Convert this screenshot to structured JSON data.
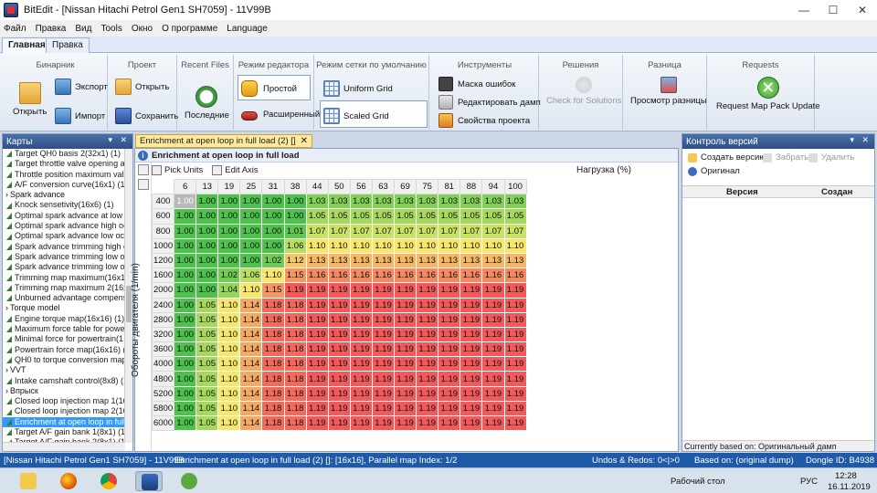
{
  "window": {
    "title": "BitEdit - [Nissan Hitachi Petrol Gen1 SH7059] - 11V99B",
    "minimize": "—",
    "maximize": "☐",
    "close": "✕"
  },
  "menu": [
    "Файл",
    "Правка",
    "Вид",
    "Tools",
    "Окно",
    "О программе",
    "Language"
  ],
  "ribbon_tabs": [
    "Главная",
    "Правка"
  ],
  "ribbon": {
    "binary": {
      "title": "Бинарник",
      "open": "Открыть",
      "export": "Экспорт",
      "import": "Импорт"
    },
    "project": {
      "title": "Проект",
      "open": "Открыть",
      "save": "Сохранить"
    },
    "recent": {
      "title": "Recent Files",
      "recent": "Последние"
    },
    "mode": {
      "title": "Режим редактора",
      "simple": "Простой",
      "advanced": "Расширенный"
    },
    "gridmode": {
      "title": "Режим сетки по умолчанию",
      "uniform": "Uniform Grid",
      "scaled": "Scaled Grid"
    },
    "tools": {
      "title": "Инструменты",
      "errmask": "Маска ошибок",
      "dtc": "Редактировать дамп",
      "props": "Свойства проекта"
    },
    "solutions": {
      "title": "Решения",
      "check": "Check for Solutions"
    },
    "diff": {
      "title": "Разница",
      "view": "Просмотр разницы"
    },
    "requests": {
      "title": "Requests",
      "update": "Request Map Pack Update"
    }
  },
  "maps_panel": {
    "title": "Карты",
    "pin": "▾ ✕",
    "items": [
      {
        "label": "Target QH0 basis 2(32x1) (1)",
        "cat": false
      },
      {
        "label": "Target throttle valve opening a",
        "cat": false
      },
      {
        "label": "Throttle position maximum val",
        "cat": false
      },
      {
        "label": "A/F conversion curve(16x1) (1)",
        "cat": false
      },
      {
        "label": "Spark advance",
        "cat": true
      },
      {
        "label": "Knock sensetivity(16x6) (1)",
        "cat": false
      },
      {
        "label": "Optimal spark advance at low l",
        "cat": false
      },
      {
        "label": "Optimal spark advance high oc",
        "cat": false
      },
      {
        "label": "Optimal spark advance low oct",
        "cat": false
      },
      {
        "label": "Spark advance trimming high c",
        "cat": false
      },
      {
        "label": "Spark advance trimming low o",
        "cat": false
      },
      {
        "label": "Spark advance trimming low o",
        "cat": false
      },
      {
        "label": "Trimming map maximum(16x1",
        "cat": false
      },
      {
        "label": "Trimming map maximum 2(16x",
        "cat": false
      },
      {
        "label": "Unburned advantage compens",
        "cat": false
      },
      {
        "label": "Torque model",
        "cat": true
      },
      {
        "label": "Engine torque map(16x16) (1)",
        "cat": false
      },
      {
        "label": "Maximum force table for powe",
        "cat": false
      },
      {
        "label": "Minimal force for powertrain(1",
        "cat": false
      },
      {
        "label": "Powertrain force map(16x16) (",
        "cat": false
      },
      {
        "label": "QH0 to torque conversion map",
        "cat": false
      },
      {
        "label": "VVT",
        "cat": true
      },
      {
        "label": "Intake camshaft control(8x8) (1",
        "cat": false
      },
      {
        "label": "Впрыск",
        "cat": true
      },
      {
        "label": "Closed loop injection map 1(16",
        "cat": false
      },
      {
        "label": "Closed loop injection map 2(16",
        "cat": false
      },
      {
        "label": "Enrichment at open loop in full",
        "cat": false,
        "selected": true
      },
      {
        "label": "Target A/F gain bank 1(8x1) (1)",
        "cat": false
      },
      {
        "label": "Target A/F gain bank 2(8x1) (1)",
        "cat": false
      }
    ]
  },
  "doc": {
    "tab": "Enrichment at open loop in full load (2) []",
    "tab_close": "✕",
    "header": "Enrichment at open loop in full load",
    "pick_units": "Pick Units",
    "edit_axis": "Edit Axis",
    "load_label": "Нагрузка (%)",
    "rpm_label": "Обороты двигателя (1/min)",
    "cols": [
      "6",
      "13",
      "19",
      "25",
      "31",
      "38",
      "44",
      "50",
      "56",
      "63",
      "69",
      "75",
      "81",
      "88",
      "94",
      "100"
    ],
    "rows": [
      {
        "rpm": "400",
        "v": [
          "1.00",
          "1.00",
          "1.00",
          "1.00",
          "1.00",
          "1.00",
          "1.03",
          "1.03",
          "1.03",
          "1.03",
          "1.03",
          "1.03",
          "1.03",
          "1.03",
          "1.03",
          "1.03"
        ]
      },
      {
        "rpm": "600",
        "v": [
          "1.00",
          "1.00",
          "1.00",
          "1.00",
          "1.00",
          "1.00",
          "1.05",
          "1.05",
          "1.05",
          "1.05",
          "1.05",
          "1.05",
          "1.05",
          "1.05",
          "1.05",
          "1.05"
        ]
      },
      {
        "rpm": "800",
        "v": [
          "1.00",
          "1.00",
          "1.00",
          "1.00",
          "1.00",
          "1.01",
          "1.07",
          "1.07",
          "1.07",
          "1.07",
          "1.07",
          "1.07",
          "1.07",
          "1.07",
          "1.07",
          "1.07"
        ]
      },
      {
        "rpm": "1000",
        "v": [
          "1.00",
          "1.00",
          "1.00",
          "1.00",
          "1.00",
          "1.06",
          "1.10",
          "1.10",
          "1.10",
          "1.10",
          "1.10",
          "1.10",
          "1.10",
          "1.10",
          "1.10",
          "1.10"
        ]
      },
      {
        "rpm": "1200",
        "v": [
          "1.00",
          "1.00",
          "1.00",
          "1.00",
          "1.02",
          "1.12",
          "1.13",
          "1.13",
          "1.13",
          "1.13",
          "1.13",
          "1.13",
          "1.13",
          "1.13",
          "1.13",
          "1.13"
        ]
      },
      {
        "rpm": "1600",
        "v": [
          "1.00",
          "1.00",
          "1.02",
          "1.06",
          "1.10",
          "1.15",
          "1.16",
          "1.16",
          "1.16",
          "1.16",
          "1.16",
          "1.16",
          "1.16",
          "1.16",
          "1.16",
          "1.16"
        ]
      },
      {
        "rpm": "2000",
        "v": [
          "1.00",
          "1.00",
          "1.04",
          "1.10",
          "1.15",
          "1.19",
          "1.19",
          "1.19",
          "1.19",
          "1.19",
          "1.19",
          "1.19",
          "1.19",
          "1.19",
          "1.19",
          "1.19"
        ]
      },
      {
        "rpm": "2400",
        "v": [
          "1.00",
          "1.05",
          "1.10",
          "1.14",
          "1.18",
          "1.18",
          "1.19",
          "1.19",
          "1.19",
          "1.19",
          "1.19",
          "1.19",
          "1.19",
          "1.19",
          "1.19",
          "1.19"
        ]
      },
      {
        "rpm": "2800",
        "v": [
          "1.00",
          "1.05",
          "1.10",
          "1.14",
          "1.18",
          "1.18",
          "1.19",
          "1.19",
          "1.19",
          "1.19",
          "1.19",
          "1.19",
          "1.19",
          "1.19",
          "1.19",
          "1.19"
        ]
      },
      {
        "rpm": "3200",
        "v": [
          "1.00",
          "1.05",
          "1.10",
          "1.14",
          "1.18",
          "1.18",
          "1.19",
          "1.19",
          "1.19",
          "1.19",
          "1.19",
          "1.19",
          "1.19",
          "1.19",
          "1.19",
          "1.19"
        ]
      },
      {
        "rpm": "3600",
        "v": [
          "1.00",
          "1.05",
          "1.10",
          "1.14",
          "1.18",
          "1.18",
          "1.19",
          "1.19",
          "1.19",
          "1.19",
          "1.19",
          "1.19",
          "1.19",
          "1.19",
          "1.19",
          "1.19"
        ]
      },
      {
        "rpm": "4000",
        "v": [
          "1.00",
          "1.05",
          "1.10",
          "1.14",
          "1.18",
          "1.18",
          "1.19",
          "1.19",
          "1.19",
          "1.19",
          "1.19",
          "1.19",
          "1.19",
          "1.19",
          "1.19",
          "1.19"
        ]
      },
      {
        "rpm": "4800",
        "v": [
          "1.00",
          "1.05",
          "1.10",
          "1.14",
          "1.18",
          "1.18",
          "1.19",
          "1.19",
          "1.19",
          "1.19",
          "1.19",
          "1.19",
          "1.19",
          "1.19",
          "1.19",
          "1.19"
        ]
      },
      {
        "rpm": "5200",
        "v": [
          "1.00",
          "1.05",
          "1.10",
          "1.14",
          "1.18",
          "1.18",
          "1.19",
          "1.19",
          "1.19",
          "1.19",
          "1.19",
          "1.19",
          "1.19",
          "1.19",
          "1.19",
          "1.19"
        ]
      },
      {
        "rpm": "5800",
        "v": [
          "1.00",
          "1.05",
          "1.10",
          "1.14",
          "1.18",
          "1.18",
          "1.19",
          "1.19",
          "1.19",
          "1.19",
          "1.19",
          "1.19",
          "1.19",
          "1.19",
          "1.19",
          "1.19"
        ]
      },
      {
        "rpm": "6000",
        "v": [
          "1.00",
          "1.05",
          "1.10",
          "1.14",
          "1.18",
          "1.18",
          "1.19",
          "1.19",
          "1.19",
          "1.19",
          "1.19",
          "1.19",
          "1.19",
          "1.19",
          "1.19",
          "1.19"
        ]
      }
    ],
    "colors": {
      "low": "#4cc24c",
      "mid": "#f6ee6e",
      "high": "#f05a5a"
    }
  },
  "versions_panel": {
    "title": "Контроль версий",
    "pin": "▾ ✕",
    "create": "Создать версию",
    "take": "Забрать",
    "delete": "Удалить",
    "original": "Оригинал",
    "col_version": "Версия",
    "col_created": "Создан",
    "footer": "Currently based on: Оригинальный дамп"
  },
  "status": {
    "project": "[Nissan Hitachi Petrol Gen1 SH7059] - 11V99B",
    "map": "Enrichment at open loop in full load (2) []: [16x16], Parallel map Index: 1/2",
    "undo": "Undos & Redos: 0<|>0",
    "based": "Based on: (original dump)",
    "dongle": "Dongle ID: B4938"
  },
  "taskbar": {
    "desktop": "Рабочий стол",
    "lang": "РУС",
    "time": "12:28",
    "date": "16.11.2019"
  }
}
